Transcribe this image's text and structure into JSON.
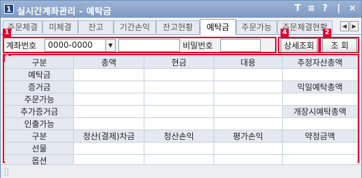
{
  "window": {
    "icon_text": "1",
    "title": "실시간계좌관리 - 예탁금"
  },
  "titlebar_buttons": [
    {
      "name": "pin-icon",
      "glyph": "T"
    },
    {
      "name": "menu-icon",
      "glyph": "≡"
    },
    {
      "name": "help-icon",
      "glyph": "?"
    },
    {
      "name": "minimize-icon",
      "glyph": "|"
    },
    {
      "name": "close-icon",
      "glyph": "×"
    }
  ],
  "tabs": [
    "주문체결",
    "미체결",
    "잔고",
    "기간손익",
    "잔고현황",
    "예탁금",
    "주문가능",
    "주문체결현황"
  ],
  "active_tab": "예탁금",
  "tab_nav": {
    "prev": "◀",
    "next": "▶"
  },
  "form": {
    "account_label": "계좌번호",
    "account_value": "0000-0000",
    "account_name_value": "",
    "password_label": "비밀번호",
    "password_value": "",
    "detail_button": "상세조회",
    "query_button": "조 회"
  },
  "badges": [
    "1",
    "2",
    "3",
    "4"
  ],
  "grid": {
    "header1": [
      "구분",
      "총액",
      "현금",
      "대용",
      "추정자산총액"
    ],
    "rows1": [
      [
        "예탁금",
        "",
        "",
        "",
        ""
      ],
      [
        "증거금",
        "",
        "",
        "",
        "익일예탁총액"
      ],
      [
        "주문가능",
        "",
        "",
        "",
        ""
      ],
      [
        "추가증거금",
        "",
        "",
        "",
        "개장시예탁총액"
      ],
      [
        "인출가능",
        "",
        "",
        "",
        ""
      ]
    ],
    "header2": [
      "구분",
      "정산(결제)차금",
      "청산손익",
      "평가손익",
      "약정금액"
    ],
    "rows2": [
      [
        "선물",
        "",
        "",
        "",
        ""
      ],
      [
        "옵션",
        "",
        "",
        "",
        ""
      ]
    ]
  },
  "colors": {
    "highlight": "#e4002b",
    "title_bg": "#8aa4c8",
    "header_bg": "#e4e9f1"
  }
}
